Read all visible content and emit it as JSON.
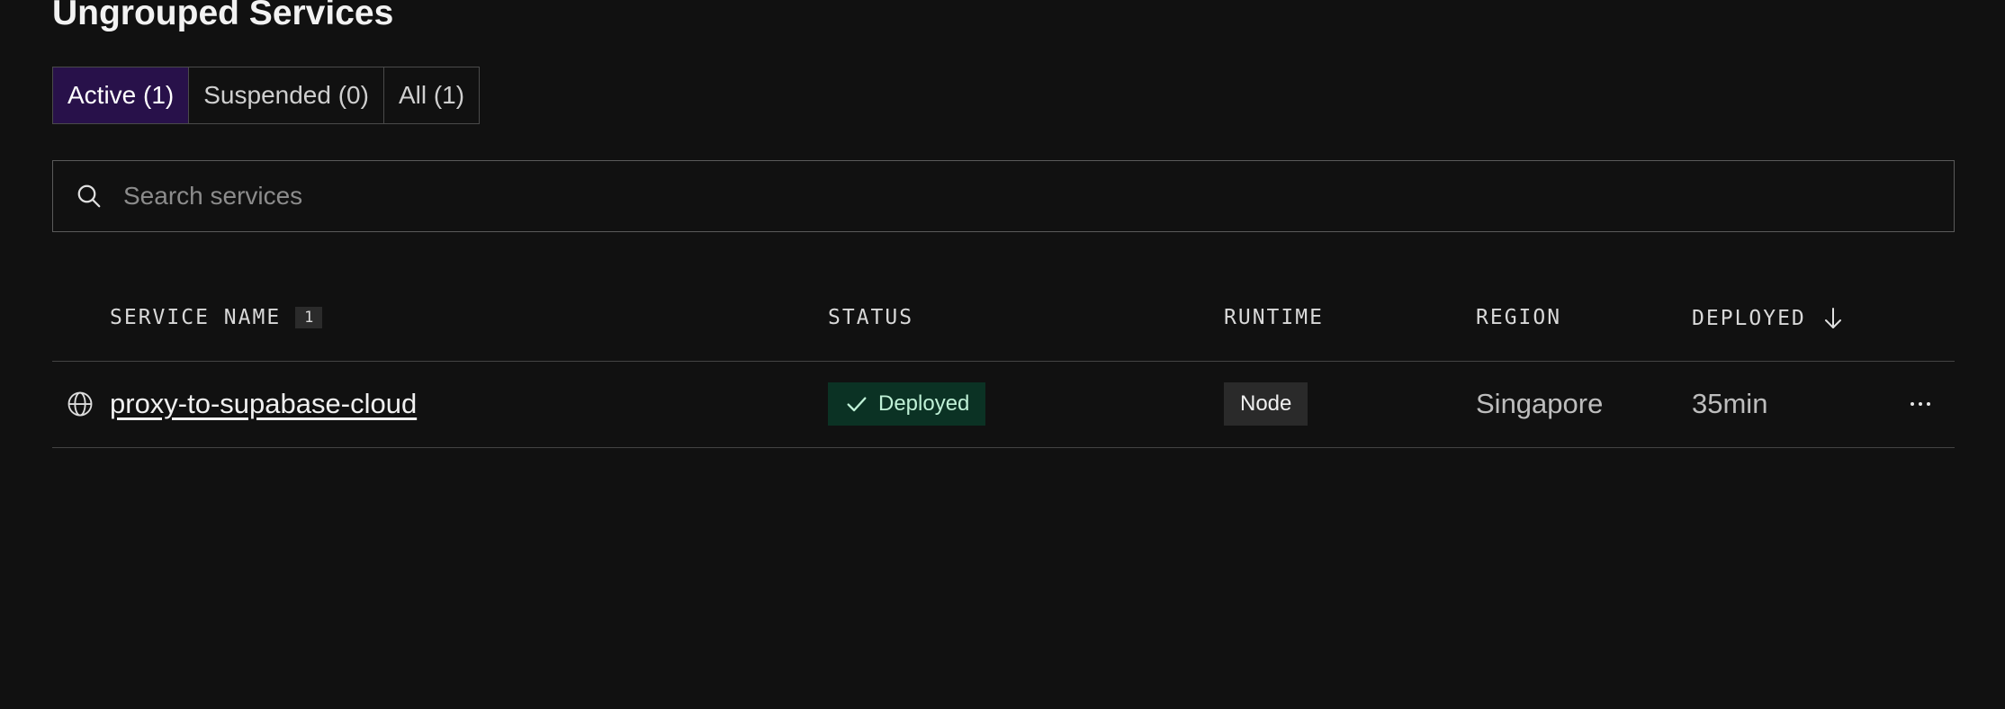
{
  "page": {
    "title": "Ungrouped Services"
  },
  "filter_tabs": [
    {
      "label": "Active (1)",
      "active": true
    },
    {
      "label": "Suspended (0)",
      "active": false
    },
    {
      "label": "All (1)",
      "active": false
    }
  ],
  "search": {
    "placeholder": "Search services",
    "value": "",
    "icon": "search-icon"
  },
  "table": {
    "columns": {
      "service_name": "SERVICE NAME",
      "service_count": "1",
      "status": "STATUS",
      "runtime": "RUNTIME",
      "region": "REGION",
      "deployed": "DEPLOYED"
    },
    "sort": {
      "column": "deployed",
      "direction": "descending",
      "icon": "arrow-down-icon"
    },
    "rows": [
      {
        "icon": "globe-icon",
        "service_name": "proxy-to-supabase-cloud",
        "status": "Deployed",
        "status_icon": "check-icon",
        "runtime": "Node",
        "region": "Singapore",
        "deployed": "35min",
        "menu_icon": "more-horizontal-icon"
      }
    ]
  },
  "colors": {
    "background": "#111111",
    "active_tab": "#28114a",
    "status_deployed_bg": "#0b3224",
    "status_deployed_text": "#bff0d6",
    "runtime_badge_bg": "#2a2a2a"
  }
}
